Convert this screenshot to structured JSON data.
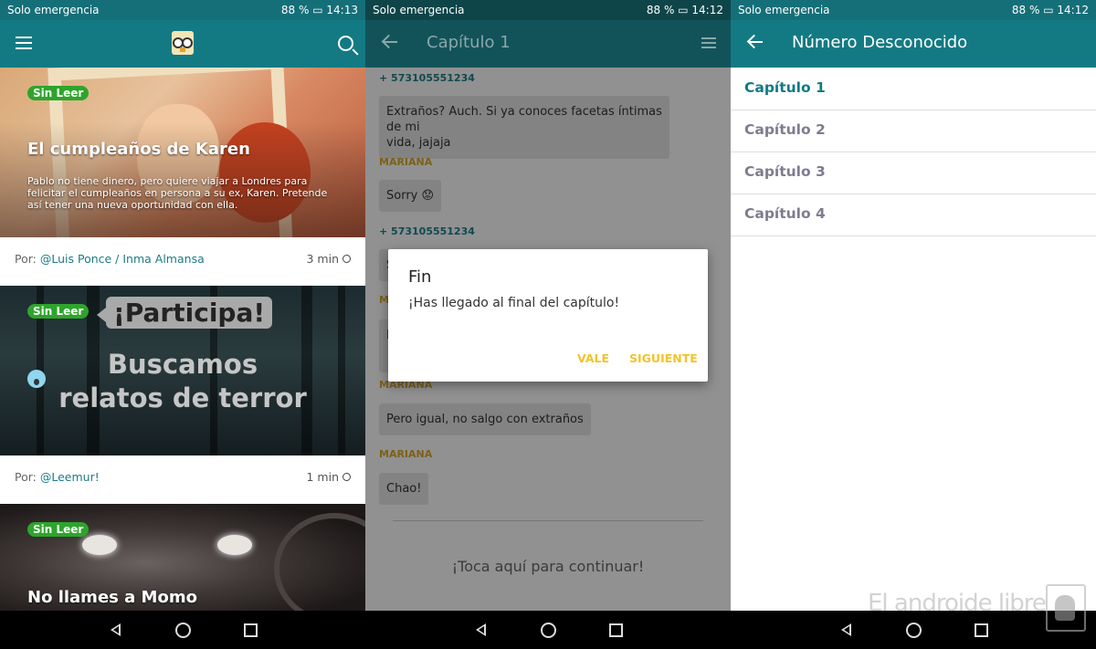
{
  "status": {
    "carrier": "Solo emergencia",
    "screens": [
      {
        "battery": "88 %",
        "time": "14:13"
      },
      {
        "battery": "88 %",
        "time": "14:12"
      },
      {
        "battery": "88 %",
        "time": "14:12"
      }
    ]
  },
  "feed": {
    "cards": [
      {
        "badge": "Sin Leer",
        "title": "El cumpleaños de Karen",
        "description": "Pablo no tiene dinero, pero quiere viajar a Londres para felicitar el cumpleaños en persona a su ex, Karen. Pretende así tener una nueva oportunidad con ella.",
        "by_label": "Por:",
        "author": "@Luis Ponce / Inma Almansa",
        "duration": "3 min"
      },
      {
        "badge": "Sin Leer",
        "bubble": "¡Participa!",
        "headline_1": "Buscamos",
        "headline_2": "relatos de terror",
        "by_label": "Por:",
        "author": "@Leemur!",
        "duration": "1 min"
      },
      {
        "badge": "Sin Leer",
        "title": "No llames a Momo"
      }
    ]
  },
  "chat": {
    "title": "Capítulo 1",
    "messages": [
      {
        "sender": "+ 573105551234",
        "text_1": "Extraños? Auch. Si ya conoces facetas íntimas de mi",
        "text_2": "vida, jajaja"
      },
      {
        "sender": "MARIANA",
        "text": "Sorry 😟"
      },
      {
        "sender": "+ 573105551234",
        "text": "S"
      },
      {
        "sender": "MARIANA",
        "text": "N"
      },
      {
        "sender": "MARIANA",
        "text": "Pero igual, no salgo con extraños"
      },
      {
        "sender": "MARIANA",
        "text": "Chao!"
      }
    ],
    "dialog": {
      "title": "Fin",
      "message": "¡Has llegado al final del capítulo!",
      "ok_label": "VALE",
      "next_label": "SIGUIENTE"
    },
    "continue_label": "¡Toca aquí para continuar!",
    "colors": {
      "sender_phone": "#1d7f88",
      "sender_name": "#d4a82a",
      "accent": "#f3c32a"
    }
  },
  "chapters": {
    "title": "Número Desconocido",
    "items": [
      {
        "label": "Capítulo 1",
        "active": true
      },
      {
        "label": "Capítulo 2",
        "active": false
      },
      {
        "label": "Capítulo 3",
        "active": false
      },
      {
        "label": "Capítulo 4",
        "active": false
      }
    ],
    "colors": {
      "active": "#137a84",
      "inactive": "#7d7d8f"
    }
  },
  "watermark": "El androide libre"
}
